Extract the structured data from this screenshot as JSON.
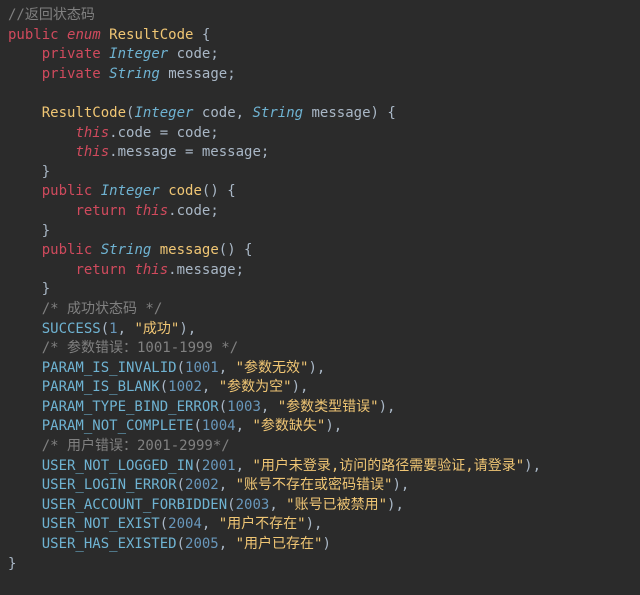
{
  "comment_top": "//返回状态码",
  "kw": {
    "public": "public",
    "enum": "enum",
    "private": "private",
    "return": "return",
    "this": "this"
  },
  "types": {
    "Integer": "Integer",
    "String": "String"
  },
  "class_name": "ResultCode",
  "fields": {
    "code": "code",
    "message": "message"
  },
  "ctor_sig_open": "(Integer code, String message) {",
  "assign_code": ".code = code;",
  "assign_msg": ".message = message;",
  "brace_close": "}",
  "method_code_sig": " code() {",
  "method_msg_sig": " message() {",
  "ret_code_tail": ".code;",
  "ret_msg_tail": ".message;",
  "cm_success": "/* 成功状态码 */",
  "cm_param": "/* 参数错误：1001-1999 */",
  "cm_user": "/* 用户错误：2001-2999*/",
  "enum_lines": {
    "success": {
      "name": "SUCCESS",
      "code": "1",
      "msg": "\"成功\"",
      "tail": "),"
    },
    "param_invalid": {
      "name": "PARAM_IS_INVALID",
      "code": "1001",
      "msg": "\"参数无效\"",
      "tail": "),"
    },
    "param_blank": {
      "name": "PARAM_IS_BLANK",
      "code": "1002",
      "msg": "\"参数为空\"",
      "tail": "),"
    },
    "param_type": {
      "name": "PARAM_TYPE_BIND_ERROR",
      "code": "1003",
      "msg": "\"参数类型错误\"",
      "tail": "),"
    },
    "param_not_complete": {
      "name": "PARAM_NOT_COMPLETE",
      "code": "1004",
      "msg": "\"参数缺失\"",
      "tail": "),"
    },
    "user_not_logged": {
      "name": "USER_NOT_LOGGED_IN",
      "code": "2001",
      "msg": "\"用户未登录,访问的路径需要验证,请登录\"",
      "tail": "),"
    },
    "user_login_err": {
      "name": "USER_LOGIN_ERROR",
      "code": "2002",
      "msg": "\"账号不存在或密码错误\"",
      "tail": "),"
    },
    "user_forbidden": {
      "name": "USER_ACCOUNT_FORBIDDEN",
      "code": "2003",
      "msg": "\"账号已被禁用\"",
      "tail": "),"
    },
    "user_not_exist": {
      "name": "USER_NOT_EXIST",
      "code": "2004",
      "msg": "\"用户不存在\"",
      "tail": "),"
    },
    "user_has_existed": {
      "name": "USER_HAS_EXISTED",
      "code": "2005",
      "msg": "\"用户已存在\"",
      "tail": ")"
    }
  }
}
